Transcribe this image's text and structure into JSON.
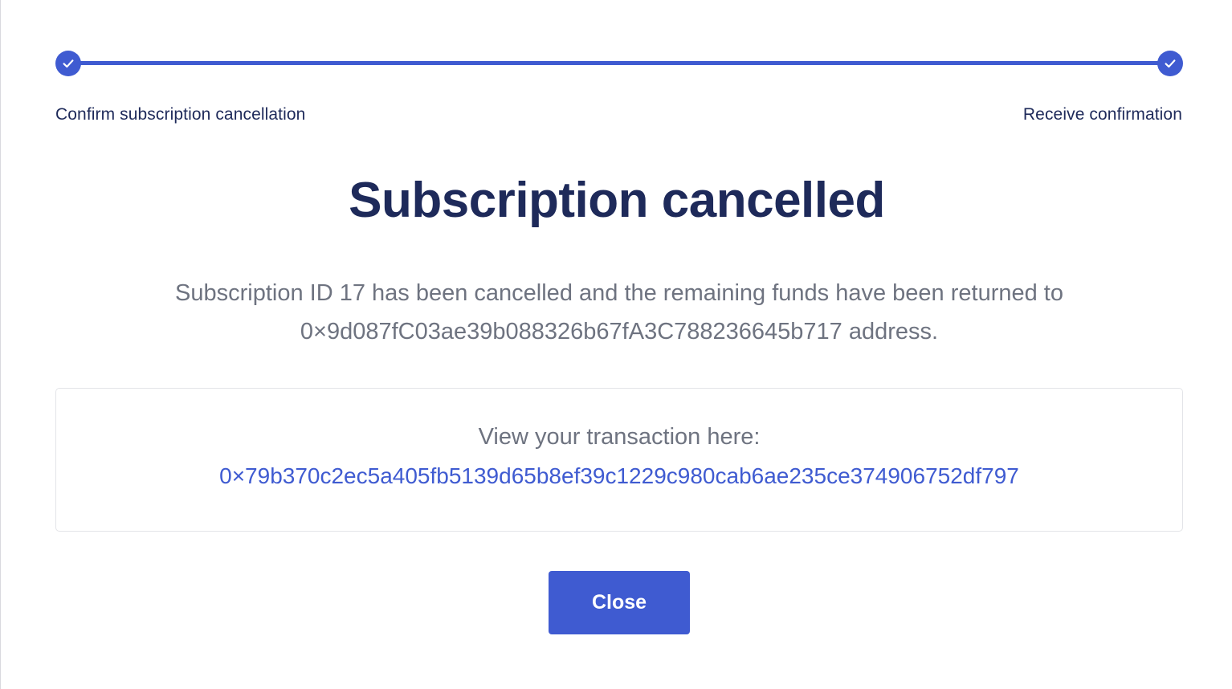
{
  "stepper": {
    "progress_percent": 100,
    "steps": [
      {
        "label": "Confirm subscription cancellation",
        "completed": true
      },
      {
        "label": "Receive confirmation",
        "completed": true
      }
    ]
  },
  "title": "Subscription cancelled",
  "message": {
    "line1": "Subscription ID 17 has been cancelled and the remaining funds have been returned to",
    "line2": "0×9d087fC03ae39b088326b67fA3C788236645b717 address."
  },
  "transaction": {
    "label": "View your transaction here:",
    "hash": "0×79b370c2ec5a405fb5139d65b8ef39c1229c980cab6ae235ce374906752df797"
  },
  "buttons": {
    "close_label": "Close"
  },
  "colors": {
    "accent": "#3f5bd1",
    "heading": "#1e2a5a",
    "body_text": "#6e7380",
    "border": "#e3e4e8"
  },
  "icons": {
    "step_complete": "check-icon"
  }
}
